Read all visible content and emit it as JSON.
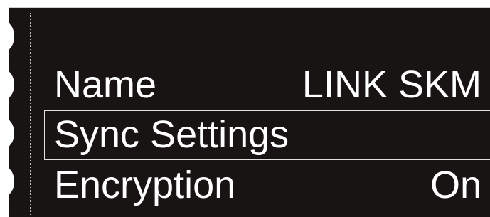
{
  "menu": {
    "items": [
      {
        "label": "Name",
        "value": "LINK SKM"
      },
      {
        "label": "Sync Settings",
        "value": ""
      },
      {
        "label": "Encryption",
        "value": "On"
      }
    ],
    "selected_index": 1
  },
  "colors": {
    "background": "#171413",
    "text": "#ffffff",
    "highlight_border": "#e0e0e0"
  }
}
